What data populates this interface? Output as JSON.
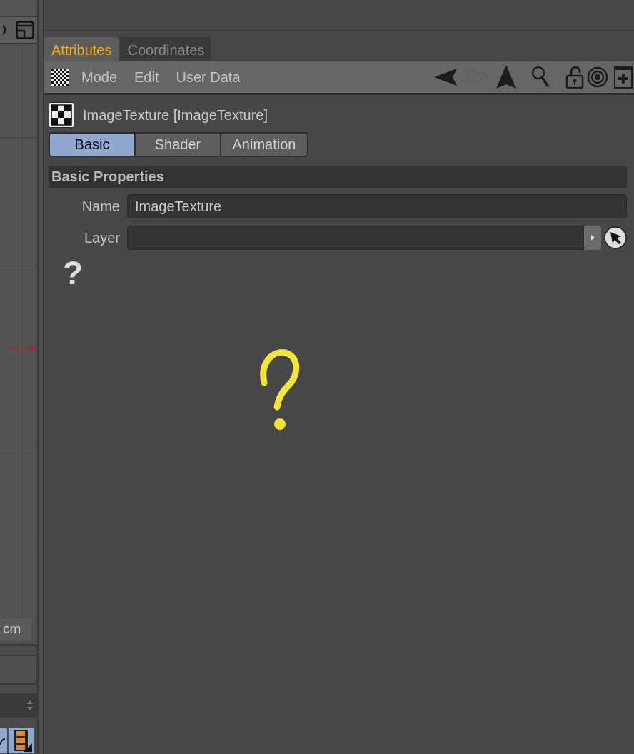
{
  "left_panel": {
    "unit": "cm"
  },
  "panel_tabs": [
    {
      "label": "Attributes",
      "selected": true
    },
    {
      "label": "Coordinates",
      "selected": false
    }
  ],
  "menu": [
    "Mode",
    "Edit",
    "User Data"
  ],
  "object": {
    "title": "ImageTexture [ImageTexture]"
  },
  "sub_tabs": [
    {
      "label": "Basic",
      "selected": true
    },
    {
      "label": "Shader",
      "selected": false
    },
    {
      "label": "Animation",
      "selected": false
    }
  ],
  "section": {
    "title": "Basic Properties",
    "fields": [
      {
        "kind": "text",
        "label": "Name",
        "value": "ImageTexture"
      },
      {
        "kind": "link",
        "label": "Layer"
      }
    ]
  },
  "help_glyph": "?"
}
